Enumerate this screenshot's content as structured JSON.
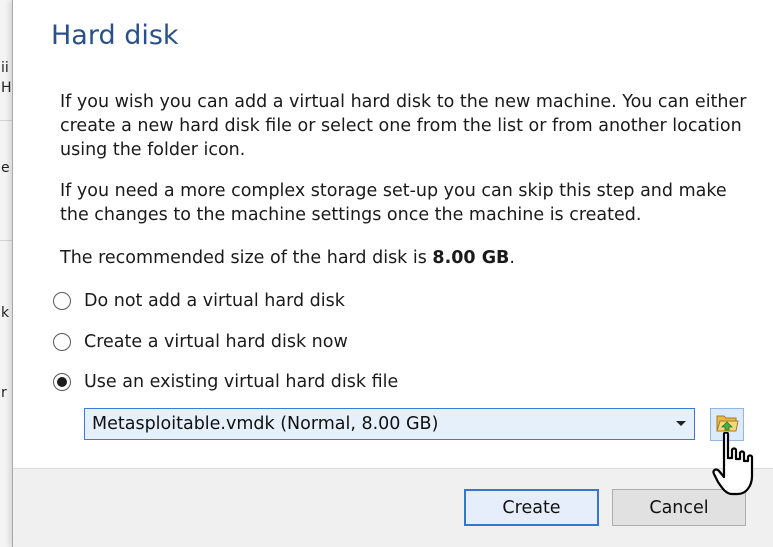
{
  "dialog": {
    "title": "Hard disk",
    "paragraph_1": "If you wish you can add a virtual hard disk to the new machine. You can either create a new hard disk file or select one from the list or from another location using the folder icon.",
    "paragraph_2": "If you need a more complex storage set-up you can skip this step and make the changes to the machine settings once the machine is created.",
    "recommended_prefix": "The recommended size of the hard disk is ",
    "recommended_size": "8.00 GB",
    "recommended_suffix": "."
  },
  "options": [
    {
      "label": "Do not add a virtual hard disk",
      "selected": false
    },
    {
      "label": "Create a virtual hard disk now",
      "selected": false
    },
    {
      "label": "Use an existing virtual hard disk file",
      "selected": true
    }
  ],
  "disk_select": {
    "value": "Metasploitable.vmdk (Normal, 8.00 GB)"
  },
  "buttons": {
    "create": "Create",
    "cancel": "Cancel"
  },
  "background_window": {
    "fragments": [
      "ii",
      "H",
      "e",
      "k",
      "r"
    ]
  },
  "colors": {
    "title": "#2a4f8f",
    "accent": "#3477d0",
    "combo_bg": "#e6f0fb"
  },
  "icons": {
    "folder_button": "folder-open-icon",
    "combo_arrow": "dropdown-arrow-icon",
    "cursor": "mouse-pointer-icon"
  }
}
